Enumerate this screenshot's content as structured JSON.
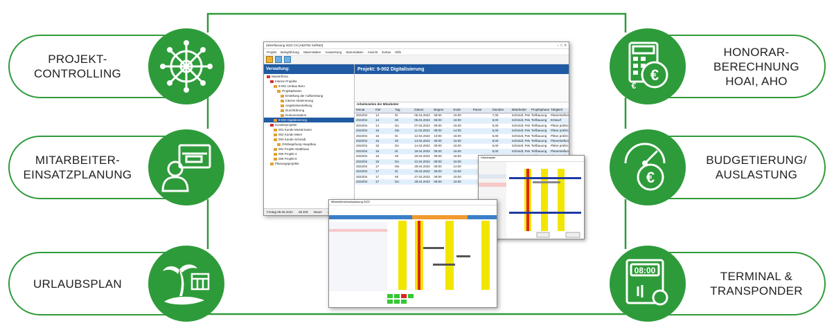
{
  "features": {
    "left": [
      {
        "label": "PROJEKT-\nCONTROLLING",
        "icon": "ship-wheel-icon"
      },
      {
        "label": "MITARBEITER-\nEINSATZPLANUNG",
        "icon": "employee-screen-icon"
      },
      {
        "label": "URLAUBSPLAN",
        "icon": "palm-island-icon"
      }
    ],
    "right": [
      {
        "label": "HONORAR-\nBERECHNUNG\nHOAI, AHO",
        "icon": "calculator-euro-icon"
      },
      {
        "label": "BUDGETIERUNG/\nAUSLASTUNG",
        "icon": "gauge-euro-icon"
      },
      {
        "label": "TERMINAL &\nTRANSPONDER",
        "icon": "terminal-transponder-icon"
      }
    ]
  },
  "colors": {
    "accent": "#2e9b3a",
    "window_blue": "#1f5aa3",
    "gantt_yellow": "#f2e600",
    "gantt_red": "#e0241a"
  },
  "window": {
    "title": "Zeiterfassung 2022 CS [AB3784 SoftNet]",
    "menu": [
      "Projekt",
      "Belegführung",
      "Stammdaten",
      "Auswertung",
      "Stammdaten",
      "Ansicht",
      "Extras",
      "Hilfe"
    ],
    "left_header": "Verwaltung:",
    "right_header": "Projekt: 9-002 Digitalisierung",
    "tree": [
      "Musterfirma",
      "Interne Projekte",
      "9-001 Umbau Büro",
      "Projektphasen",
      "Erstellung der Aufbereitung",
      "Interne Abstimmung",
      "Angebotserstellung",
      "Durchführung",
      "Dokumentation",
      "9-002 Digitalisierung",
      "Kundenprojekte",
      "001 Kunde Mustermann",
      "002 Kunde Meier",
      "003 Kunde Schmidt",
      "Ortsbegehung Hauptbau",
      "004 Projekt Stadthaus",
      "005 Projekt 4",
      "006 Projekt 5",
      "Planungsprojekte"
    ],
    "section_title": "Arbeitszeiten der Mitarbeiter",
    "columns": [
      "Monat",
      "KW",
      "Tag",
      "Datum",
      "Beginn",
      "Ende",
      "Pause",
      "Stunden",
      "Mitarbeiter",
      "Projektphase",
      "Tätigkeit"
    ],
    "rows": [
      [
        "2022/04",
        "14",
        "Di",
        "05.04.2022",
        "08:00",
        "15:00",
        "",
        "7,00",
        "Schmidt, Peter",
        "Tiefbauung",
        "Planerstellung"
      ],
      [
        "2022/04",
        "14",
        "Mi",
        "06.04.2022",
        "08:00",
        "16:00",
        "",
        "8,00",
        "Schmidt, Peter",
        "Tiefbauung",
        "Entwurf"
      ],
      [
        "2022/04",
        "14",
        "Do",
        "07.04.2022",
        "09:00",
        "15:00",
        "",
        "6,00",
        "Schmidt, Peter",
        "Tiefbauung",
        "Pläne prüfen"
      ],
      [
        "2022/04",
        "15",
        "Mo",
        "11.04.2022",
        "08:00",
        "14:00",
        "",
        "6,00",
        "Schmidt, Peter",
        "Tiefbauung",
        "Pläne prüfen"
      ],
      [
        "2022/04",
        "15",
        "Di",
        "12.04.2022",
        "10:00",
        "15:00",
        "",
        "5,00",
        "Schmidt, Peter",
        "Tiefbauung",
        "Pläne prüfen"
      ],
      [
        "2022/04",
        "15",
        "Mi",
        "13.04.2022",
        "08:00",
        "16:00",
        "",
        "8,00",
        "Schmidt, Peter",
        "Tiefbauung",
        "Planerstellung"
      ],
      [
        "2022/04",
        "15",
        "Do",
        "14.04.2022",
        "09:00",
        "15:00",
        "",
        "6,00",
        "Schmidt, Peter",
        "Tiefbauung",
        "Pläne prüfen"
      ],
      [
        "2022/04",
        "16",
        "Di",
        "19.04.2022",
        "08:00",
        "16:00",
        "",
        "8,00",
        "Schmidt, Peter",
        "Tiefbauung",
        "Planerstellung"
      ],
      [
        "2022/04",
        "16",
        "Mi",
        "20.04.2022",
        "08:00",
        "15:00",
        "",
        "7,00",
        "Schmidt, Peter",
        "Tiefbauung",
        "Pläne prüfen"
      ],
      [
        "2022/04",
        "16",
        "Do",
        "21.04.2022",
        "09:00",
        "16:00",
        "",
        "7,00",
        "Schmidt, Peter",
        "Tiefbauung",
        "Entwurf"
      ],
      [
        "2022/04",
        "17",
        "Mo",
        "25.04.2022",
        "08:00",
        "14:00",
        "",
        "6,00",
        "Schmidt, Peter",
        "Tiefbauung",
        "Pläne prüfen"
      ],
      [
        "2022/04",
        "17",
        "Di",
        "26.04.2022",
        "08:00",
        "16:00",
        "",
        "8,00",
        "Schmidt, Peter",
        "Tiefbauung",
        "Planerstellung"
      ],
      [
        "2022/04",
        "17",
        "Mi",
        "27.04.2022",
        "09:00",
        "15:00",
        "",
        "6,00",
        "Schmidt, Peter",
        "Tiefbauung",
        "Pläne prüfen"
      ],
      [
        "2022/04",
        "17",
        "Do",
        "28.04.2022",
        "08:00",
        "16:00",
        "",
        "8,00",
        "Schmidt, Peter",
        "Tiefbauung",
        "Entwurf"
      ]
    ],
    "status": [
      "Freitag 08.05.2022",
      "Sb EW",
      "Neuer",
      "Administrator"
    ]
  },
  "planning_window": {
    "title": "Urlaubsplan",
    "month1": "September 2021",
    "month2": "Oktober 2021"
  },
  "gantt_window": {
    "title": "Mitarbeitereinsatzplanung 2022"
  }
}
